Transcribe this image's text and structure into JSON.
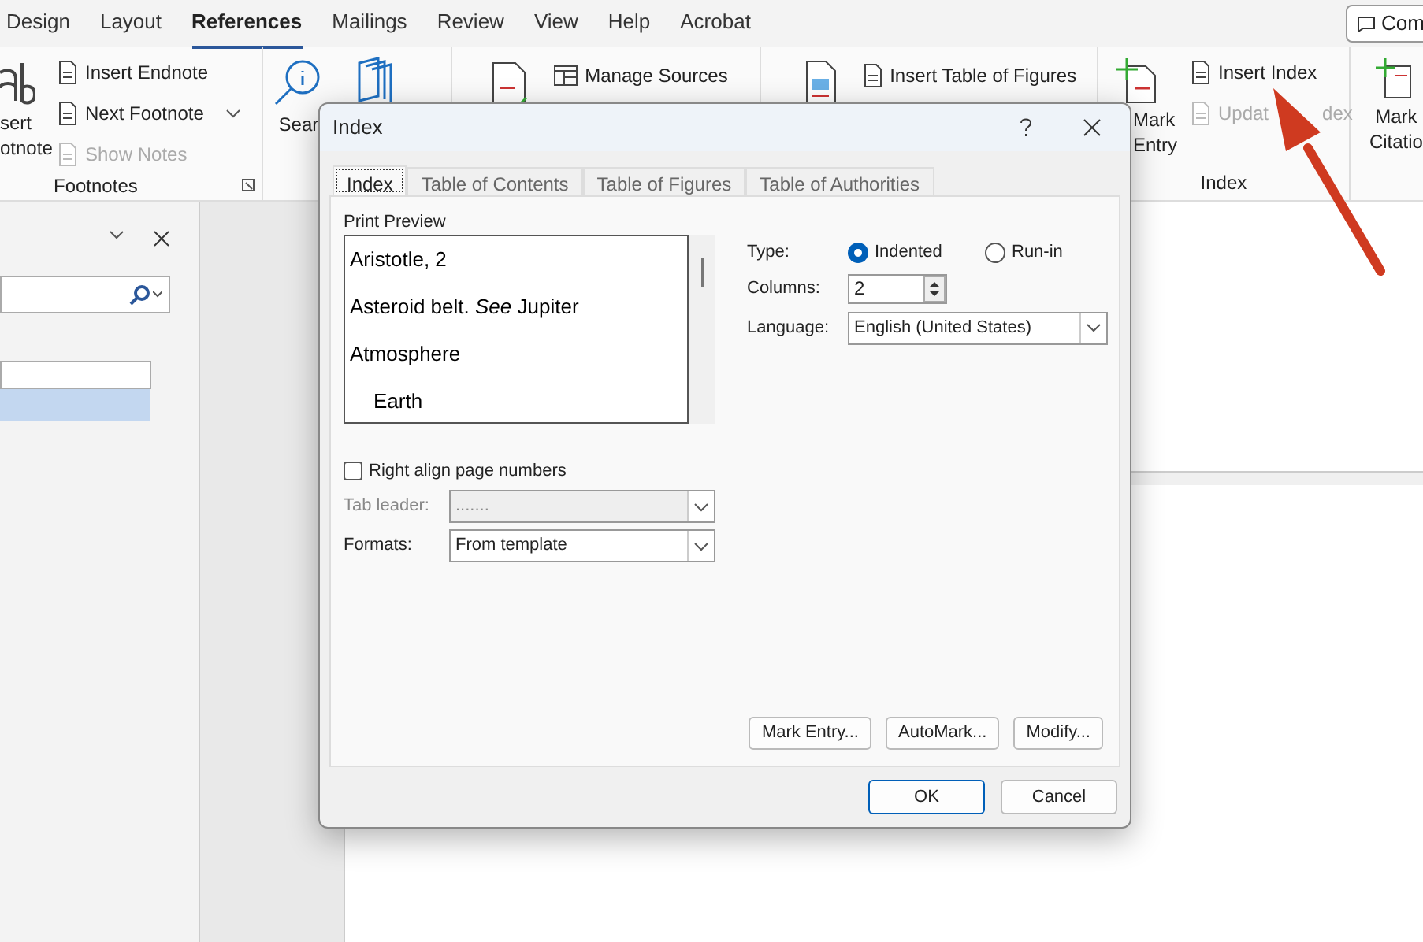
{
  "ribbon_tabs": [
    {
      "label": "Design",
      "selected": false
    },
    {
      "label": "Layout",
      "selected": false
    },
    {
      "label": "References",
      "selected": true
    },
    {
      "label": "Mailings",
      "selected": false
    },
    {
      "label": "Review",
      "selected": false
    },
    {
      "label": "View",
      "selected": false
    },
    {
      "label": "Help",
      "selected": false
    },
    {
      "label": "Acrobat",
      "selected": false
    }
  ],
  "comments_button": "Com",
  "footnotes_group": {
    "big_button": [
      "sert",
      "otnote"
    ],
    "items": [
      {
        "label": "Insert Endnote",
        "disabled": false
      },
      {
        "label": "Next Footnote",
        "disabled": false
      },
      {
        "label": "Show Notes",
        "disabled": true
      }
    ],
    "label": "Footnotes"
  },
  "search_button": "Sear",
  "manage_sources": "Manage Sources",
  "insert_table_of_figures": "Insert Table of Figures",
  "index_group": {
    "mark_entry": [
      "Mark",
      "Entry"
    ],
    "items": [
      {
        "label": "Insert Index",
        "disabled": false
      },
      {
        "label": "Updat",
        "tail": "dex",
        "disabled": true
      }
    ],
    "label": "Index"
  },
  "mark_citation": [
    "Mark",
    "Citatio"
  ],
  "dialog": {
    "title": "Index",
    "tabs": [
      {
        "label": "Index",
        "selected": true
      },
      {
        "label": "Table of Contents",
        "selected": false
      },
      {
        "label": "Table of Figures",
        "selected": false
      },
      {
        "label": "Table of Authorities",
        "selected": false
      }
    ],
    "print_preview": {
      "label": "Print Preview",
      "entries": [
        {
          "text": "Aristotle, 2"
        },
        {
          "text": "Asteroid belt. *See* Jupiter"
        },
        {
          "text": "Atmosphere",
          "children": [
            {
              "text": "Earth"
            }
          ]
        }
      ]
    },
    "type": {
      "label": "Type:",
      "options": [
        {
          "label": "Indented",
          "selected": true
        },
        {
          "label": "Run-in",
          "selected": false
        }
      ]
    },
    "columns": {
      "label": "Columns:",
      "value": "2"
    },
    "language": {
      "label": "Language:",
      "value": "English (United States)"
    },
    "right_align": {
      "label": "Right align page numbers",
      "checked": false
    },
    "tab_leader": {
      "label": "Tab leader:",
      "value": ".......",
      "disabled": true
    },
    "formats": {
      "label": "Formats:",
      "value": "From template"
    },
    "buttons": [
      "Mark Entry...",
      "AutoMark...",
      "Modify..."
    ],
    "footer_buttons": [
      {
        "label": "OK",
        "default": true
      },
      {
        "label": "Cancel",
        "default": false
      }
    ]
  }
}
